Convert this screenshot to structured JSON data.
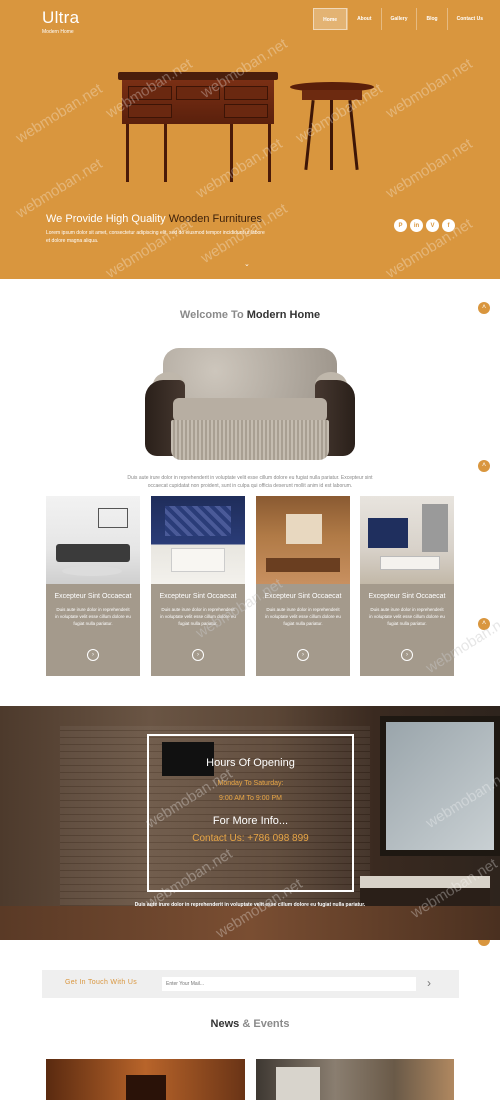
{
  "brand": {
    "title": "Ultra",
    "subtitle": "Modern Home"
  },
  "nav": {
    "items": [
      "Home",
      "About",
      "Gallery",
      "Blog",
      "Contact Us"
    ],
    "active": "Home"
  },
  "hero": {
    "heading_prefix": "We Provide High Quality",
    "heading_accent": "Wooden Furnitures",
    "text": "Lorem ipsum dolor sit amet, consectetur adipiscing elit, sed do eiusmod tempor incididunt ut labore et dolore magna aliqua.",
    "social": [
      {
        "icon": "pinterest-icon",
        "glyph": "P"
      },
      {
        "icon": "linkedin-icon",
        "glyph": "in"
      },
      {
        "icon": "vimeo-icon",
        "glyph": "V"
      },
      {
        "icon": "facebook-icon",
        "glyph": "f"
      }
    ],
    "scroll_glyph": "⌄"
  },
  "welcome": {
    "title_prefix": "Welcome To",
    "title_dark": "Modern Home",
    "text": "Duis aute irure dolor in reprehenderit in voluptate velit esse cillum dolore eu fugiat nulla pariatur. Excepteur sint occaecat cupidatat non proident, sunt in culpa qui officia deserunt mollit anim id est laborum."
  },
  "cards": [
    {
      "title": "Excepteur Sint Occaecat",
      "text": "Duis aute irure dolor in reprehenderit in voluptate velit esse cillum dolore eu fugiat nulla pariatur."
    },
    {
      "title": "Excepteur Sint Occaecat",
      "text": "Duis aute irure dolor in reprehenderit in voluptate velit esse cillum dolore eu fugiat nulla pariatur."
    },
    {
      "title": "Excepteur Sint Occaecat",
      "text": "Duis aute irure dolor in reprehenderit in voluptate velit esse cillum dolore eu fugiat nulla pariatur."
    },
    {
      "title": "Excepteur Sint Occaecat",
      "text": "Duis aute irure dolor in reprehenderit in voluptate velit esse cillum dolore eu fugiat nulla pariatur."
    }
  ],
  "hours": {
    "title": "Hours Of Opening",
    "days": "Monday To Saturday:",
    "time": "9:00 AM To 9:00 PM",
    "more": "For More Info...",
    "contact": "Contact Us: +786 098 899",
    "note": "Duis aute irure dolor in reprehenderit in voluptate velit esse cillum dolore eu fugiat nulla pariatur."
  },
  "newsletter": {
    "label": "Get In Touch With Us",
    "placeholder": "Enter Your Mail...",
    "send_glyph": "›"
  },
  "news": {
    "title_dark": "News",
    "title_suffix": "& Events"
  },
  "watermark": "webmoban.net",
  "colors": {
    "accent": "#d9963e",
    "card": "#a49a8c",
    "dark_text": "#333333"
  }
}
